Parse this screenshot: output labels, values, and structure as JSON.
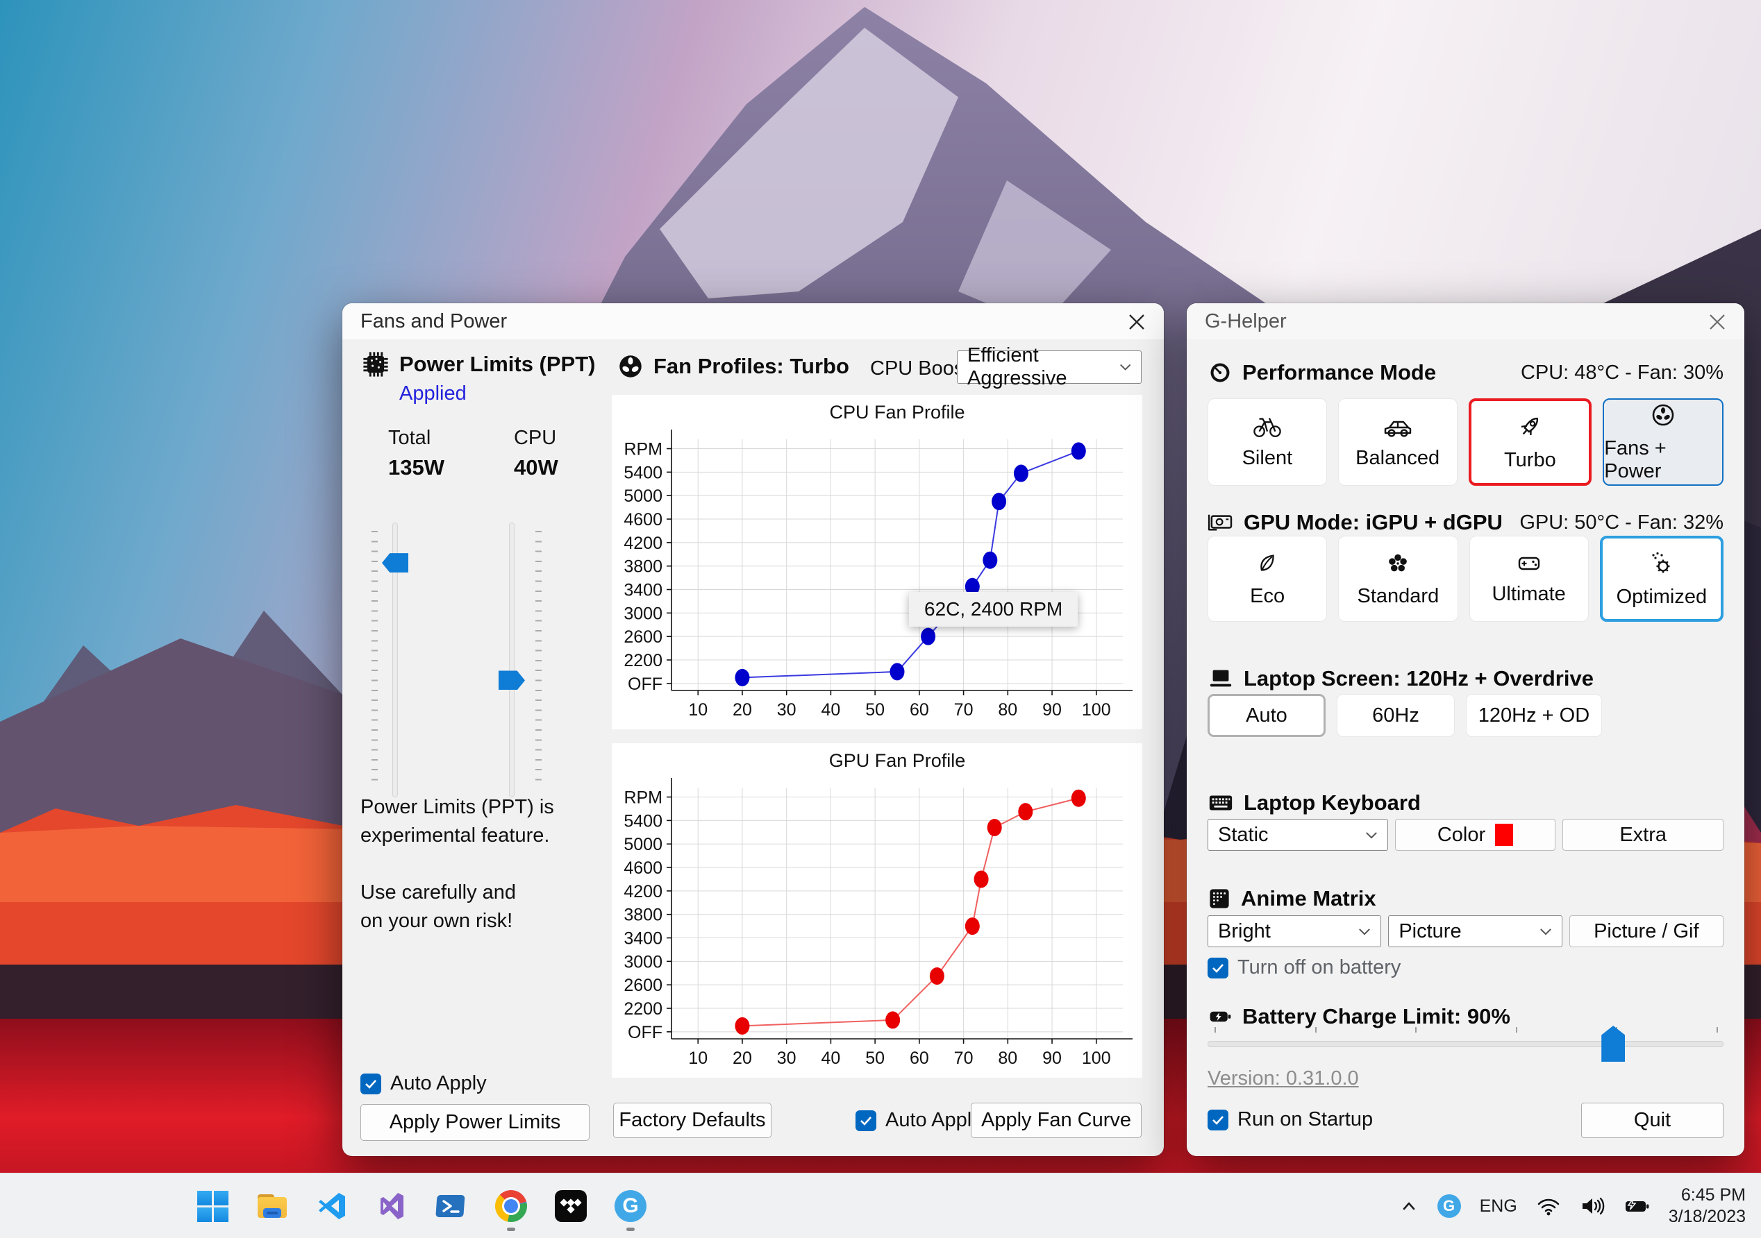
{
  "colors": {
    "accent_blue": "#0f7cd6",
    "checkbox_blue": "#0067c0",
    "turbo_border_red": "#ea1c22",
    "optimized_border_blue": "#2d9fe0",
    "applied_text_blue": "#2323dd",
    "keyboard_color_swatch": "#fe0000",
    "cpu_curve_color": "#0000cd",
    "gpu_curve_color": "#e80000"
  },
  "fans_window": {
    "title": "Fans and Power",
    "power_limits": {
      "header": "Power Limits (PPT)",
      "status": "Applied",
      "total_label": "Total",
      "total_value": "135W",
      "cpu_label": "CPU",
      "cpu_value": "40W",
      "sliders": {
        "total": {
          "fraction": 0.12
        },
        "cpu": {
          "fraction": 0.58
        }
      },
      "warning_1": "Power Limits (PPT) is",
      "warning_2": "experimental feature.",
      "warning_3": "Use carefully and",
      "warning_4": "on your own risk!",
      "auto_apply_label": "Auto Apply",
      "apply_button": "Apply Power Limits"
    },
    "fan_profiles": {
      "header": "Fan Profiles: Turbo",
      "cpu_boost_label": "CPU Boost",
      "cpu_boost_value": "Efficient Aggressive"
    },
    "footer": {
      "factory_defaults": "Factory Defaults",
      "auto_apply_label": "Auto Apply",
      "apply_fan_curve": "Apply Fan Curve"
    }
  },
  "chart_data": [
    {
      "id": "cpu",
      "type": "line",
      "title": "CPU Fan Profile",
      "xlabel": "",
      "ylabel": "RPM",
      "x_ticks": [
        10,
        20,
        30,
        40,
        50,
        60,
        70,
        80,
        90,
        100
      ],
      "y_ticks": [
        {
          "label": "RPM",
          "value": 5800
        },
        {
          "label": "5400",
          "value": 5400
        },
        {
          "label": "5000",
          "value": 5000
        },
        {
          "label": "4600",
          "value": 4600
        },
        {
          "label": "4200",
          "value": 4200
        },
        {
          "label": "3800",
          "value": 3800
        },
        {
          "label": "3400",
          "value": 3400
        },
        {
          "label": "3000",
          "value": 3000
        },
        {
          "label": "2600",
          "value": 2600
        },
        {
          "label": "2200",
          "value": 2200
        },
        {
          "label": "OFF",
          "value": 1800
        }
      ],
      "x_range": [
        4,
        106
      ],
      "y_range": [
        1680,
        5960
      ],
      "points": [
        [
          20,
          1900
        ],
        [
          55,
          2000
        ],
        [
          62,
          2600
        ],
        [
          72,
          3450
        ],
        [
          76,
          3900
        ],
        [
          78,
          4900
        ],
        [
          83,
          5380
        ],
        [
          96,
          5760
        ]
      ],
      "line_color": "#3a3ae0",
      "marker_color": "#0000cd",
      "grid": true,
      "tooltip": {
        "text": "62C, 2400 RPM"
      }
    },
    {
      "id": "gpu",
      "type": "line",
      "title": "GPU Fan Profile",
      "xlabel": "",
      "ylabel": "RPM",
      "x_ticks": [
        10,
        20,
        30,
        40,
        50,
        60,
        70,
        80,
        90,
        100
      ],
      "y_ticks": [
        {
          "label": "RPM",
          "value": 5800
        },
        {
          "label": "5400",
          "value": 5400
        },
        {
          "label": "5000",
          "value": 5000
        },
        {
          "label": "4600",
          "value": 4600
        },
        {
          "label": "4200",
          "value": 4200
        },
        {
          "label": "3800",
          "value": 3800
        },
        {
          "label": "3400",
          "value": 3400
        },
        {
          "label": "3000",
          "value": 3000
        },
        {
          "label": "2600",
          "value": 2600
        },
        {
          "label": "2200",
          "value": 2200
        },
        {
          "label": "OFF",
          "value": 1800
        }
      ],
      "x_range": [
        4,
        106
      ],
      "y_range": [
        1680,
        5960
      ],
      "points": [
        [
          20,
          1900
        ],
        [
          54,
          2000
        ],
        [
          64,
          2750
        ],
        [
          72,
          3600
        ],
        [
          74,
          4400
        ],
        [
          77,
          5280
        ],
        [
          84,
          5550
        ],
        [
          96,
          5780
        ]
      ],
      "line_color": "#f06060",
      "marker_color": "#e80000",
      "grid": true
    }
  ],
  "ghelper_window": {
    "title": "G-Helper",
    "performance": {
      "header": "Performance Mode",
      "status": "CPU: 48°C -  Fan: 30%",
      "modes": [
        {
          "label": "Silent"
        },
        {
          "label": "Balanced"
        },
        {
          "label": "Turbo"
        },
        {
          "label": "Fans + Power"
        }
      ]
    },
    "gpu": {
      "header": "GPU Mode: iGPU + dGPU",
      "status": "GPU: 50°C -  Fan: 32%",
      "modes": [
        {
          "label": "Eco"
        },
        {
          "label": "Standard"
        },
        {
          "label": "Ultimate"
        },
        {
          "label": "Optimized"
        }
      ]
    },
    "screen": {
      "header": "Laptop Screen: 120Hz + Overdrive",
      "options": [
        {
          "label": "Auto"
        },
        {
          "label": "60Hz"
        },
        {
          "label": "120Hz + OD"
        }
      ]
    },
    "keyboard": {
      "header": "Laptop Keyboard",
      "mode_value": "Static",
      "color_label": "Color",
      "extra_label": "Extra"
    },
    "anime": {
      "header": "Anime Matrix",
      "brightness_value": "Bright",
      "mode_value": "Picture",
      "picture_button": "Picture / Gif",
      "battery_checkbox": "Turn off on battery"
    },
    "battery": {
      "header": "Battery Charge Limit: 90%",
      "value": 90,
      "min": 50,
      "max": 100,
      "fraction": 0.8
    },
    "version": "Version: 0.31.0.0",
    "run_on_startup": "Run on Startup",
    "quit": "Quit"
  },
  "taskbar": {
    "icons": [
      "start",
      "file-explorer",
      "vscode",
      "visual-studio",
      "powershell",
      "chrome",
      "tidal",
      "ghelper"
    ],
    "tray": {
      "language": "ENG",
      "time": "6:45 PM",
      "date": "3/18/2023"
    }
  }
}
